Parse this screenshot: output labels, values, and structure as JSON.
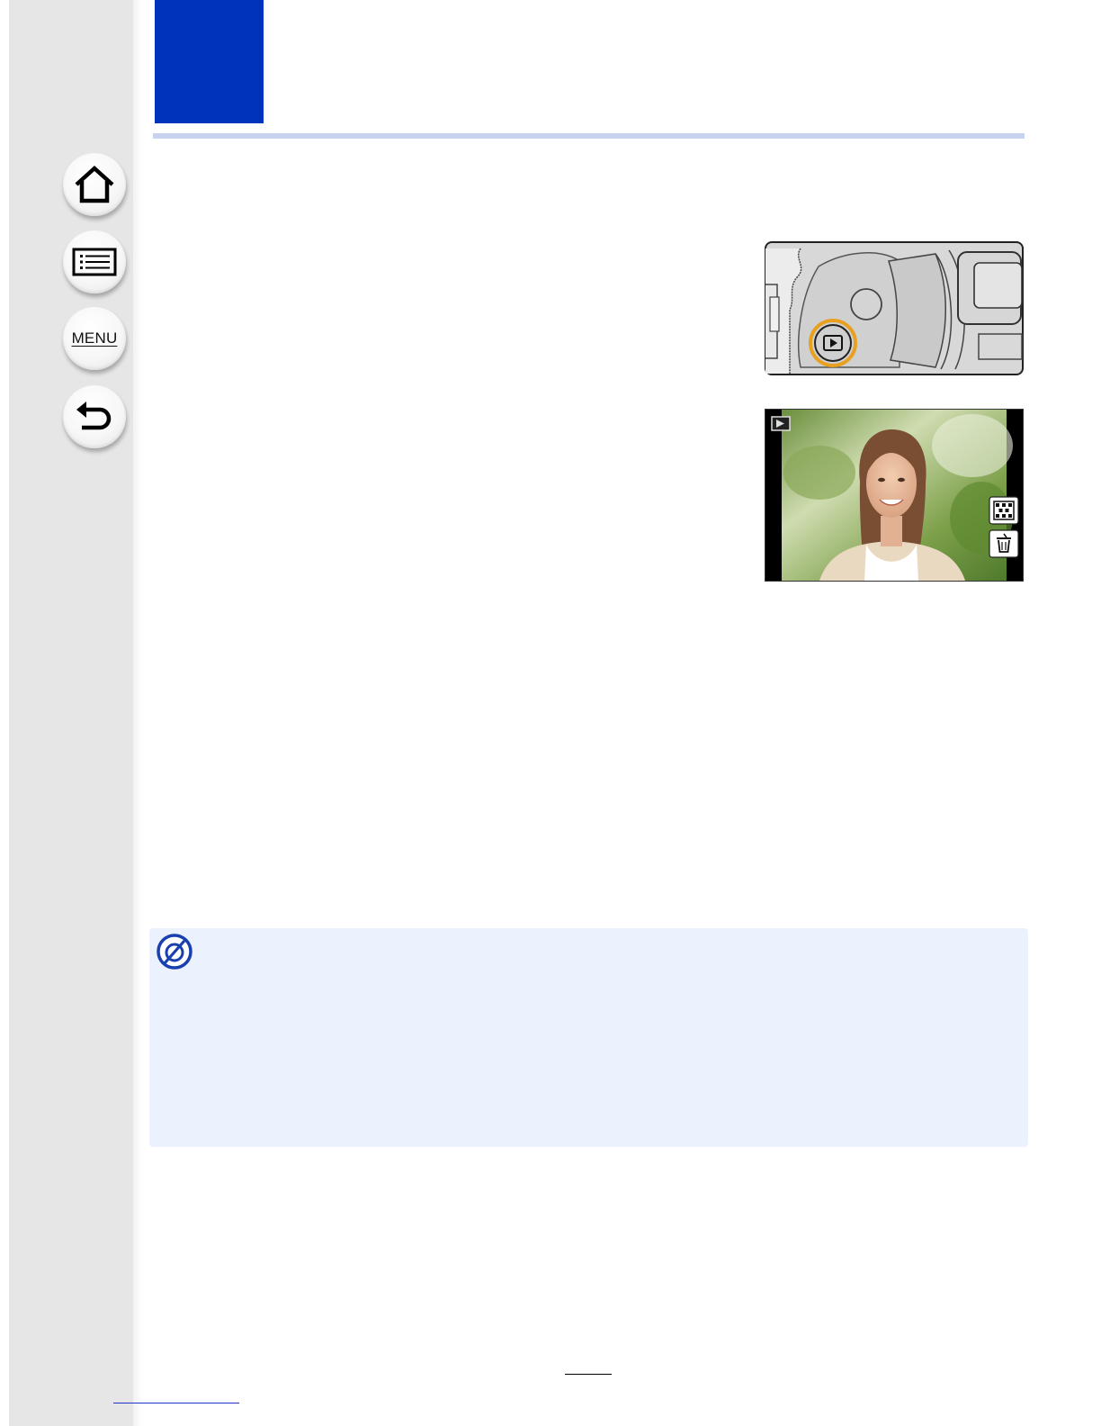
{
  "sidebar": {
    "buttons": [
      {
        "name": "home-button",
        "icon": "home-icon"
      },
      {
        "name": "contents-button",
        "icon": "list-icon"
      },
      {
        "name": "menu-button",
        "icon": "menu-icon",
        "label": "MENU"
      },
      {
        "name": "back-button",
        "icon": "return-arrow-icon"
      }
    ]
  },
  "colors": {
    "chapter_tab": "#0033bb",
    "header_rule": "#c6d2ee",
    "note_background": "#ebf2fd",
    "highlight_ring": "#e8a020"
  },
  "figure_button": {
    "icon": "playback-button-icon"
  },
  "figure_screen": {
    "icons": [
      "playback-mode-icon",
      "thumbnail-grid-icon",
      "trash-icon"
    ]
  },
  "note": {
    "icon": "not-available-icon"
  },
  "page": {
    "number": "",
    "link": ""
  }
}
